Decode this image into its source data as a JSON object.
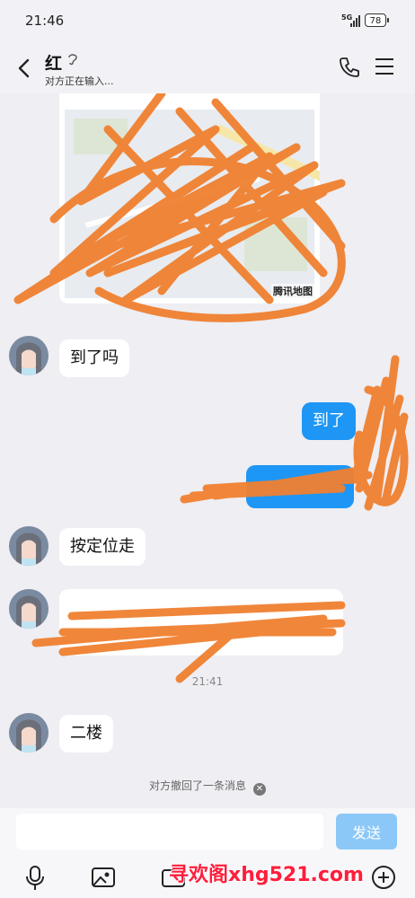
{
  "status": {
    "time": "21:46",
    "network": "5G",
    "battery": "78"
  },
  "header": {
    "contact_name": "红",
    "status_text": "对方正在输入..."
  },
  "map": {
    "provider_label": "腾讯地图"
  },
  "messages": [
    {
      "from": "them",
      "text": "到了吗"
    },
    {
      "from": "me",
      "text": "到了"
    },
    {
      "from": "them",
      "text": "按定位走"
    },
    {
      "from": "them",
      "text": ""
    },
    {
      "timestamp": "21:41"
    },
    {
      "from": "them",
      "text": "二楼"
    }
  ],
  "notice": {
    "text": "对方撤回了一条消息"
  },
  "input": {
    "value": "",
    "send_label": "发送"
  },
  "watermark": "寻欢阁xhg521.com",
  "colors": {
    "accent": "#1e96f5",
    "send_disabled": "#8cc8f7",
    "scribble": "#f08030",
    "background": "#eeeef3"
  }
}
